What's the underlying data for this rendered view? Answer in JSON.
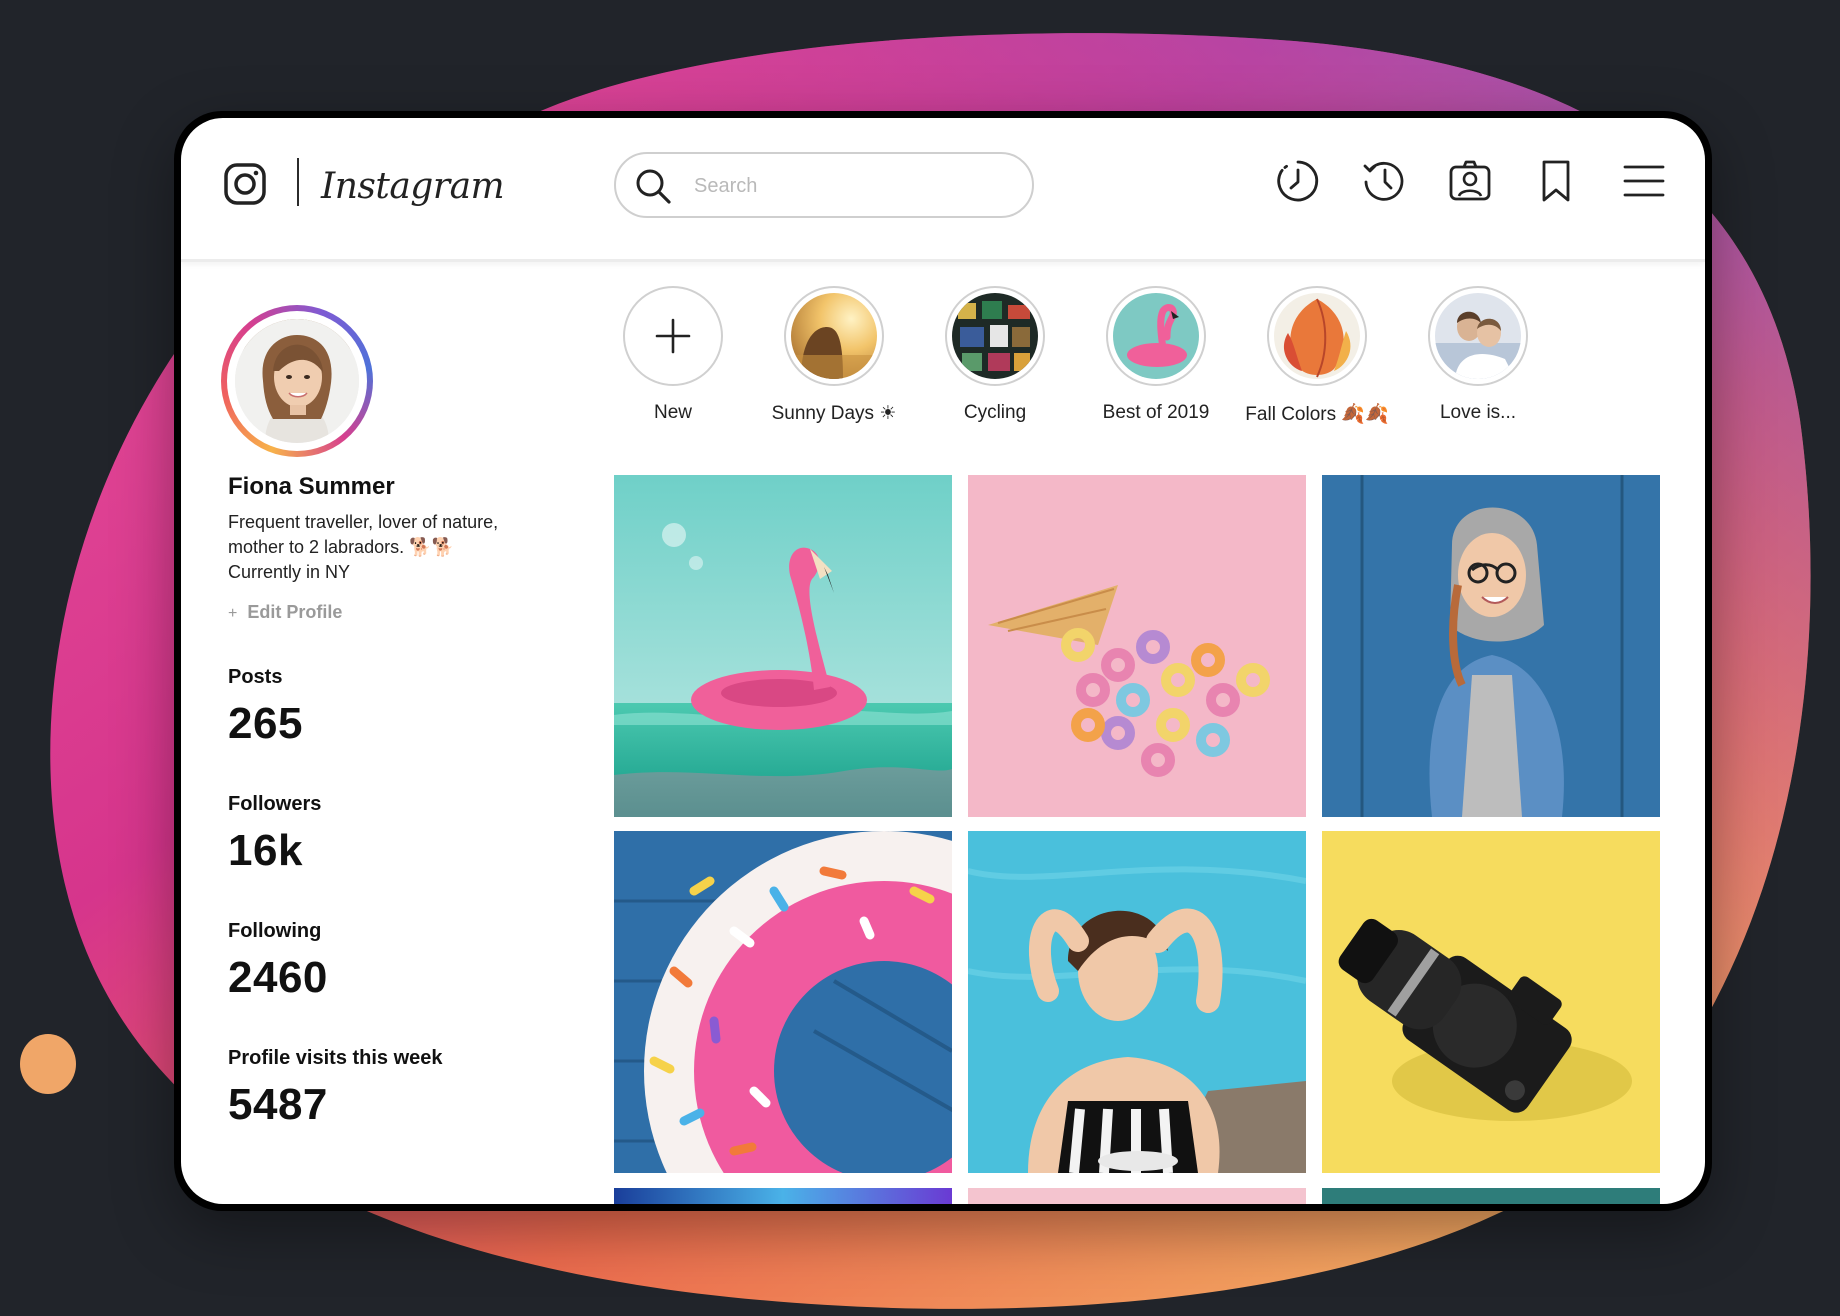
{
  "app": {
    "name": "Instagram",
    "logo_icon": "instagram-camera-icon"
  },
  "search": {
    "placeholder": "Search",
    "value": ""
  },
  "nav_icons": [
    "activity-icon",
    "history-icon",
    "profile-card-icon",
    "bookmark-icon",
    "menu-icon"
  ],
  "profile": {
    "name": "Fiona Summer",
    "bio_lines": [
      "Frequent traveller, lover of nature,",
      "mother to 2 labradors. 🐕🐕",
      "Currently in NY"
    ],
    "edit_label": "Edit Profile",
    "edit_prefix": "+",
    "stats": [
      {
        "label": "Posts",
        "value": "265"
      },
      {
        "label": "Followers",
        "value": "16k"
      },
      {
        "label": "Following",
        "value": "2460"
      },
      {
        "label": "Profile visits this week",
        "value": "5487"
      }
    ]
  },
  "stories": [
    {
      "label": "New"
    },
    {
      "label": "Sunny Days ☀"
    },
    {
      "label": "Cycling"
    },
    {
      "label": "Best of 2019"
    },
    {
      "label": "Fall Colors 🍂🍂"
    },
    {
      "label": "Love is..."
    }
  ],
  "colors": {
    "gradient_pink": "#d6358c",
    "gradient_purple": "#8a5bc4",
    "gradient_orange": "#f0824b",
    "gradient_yellow": "#f6c46a",
    "background": "#21242a"
  }
}
